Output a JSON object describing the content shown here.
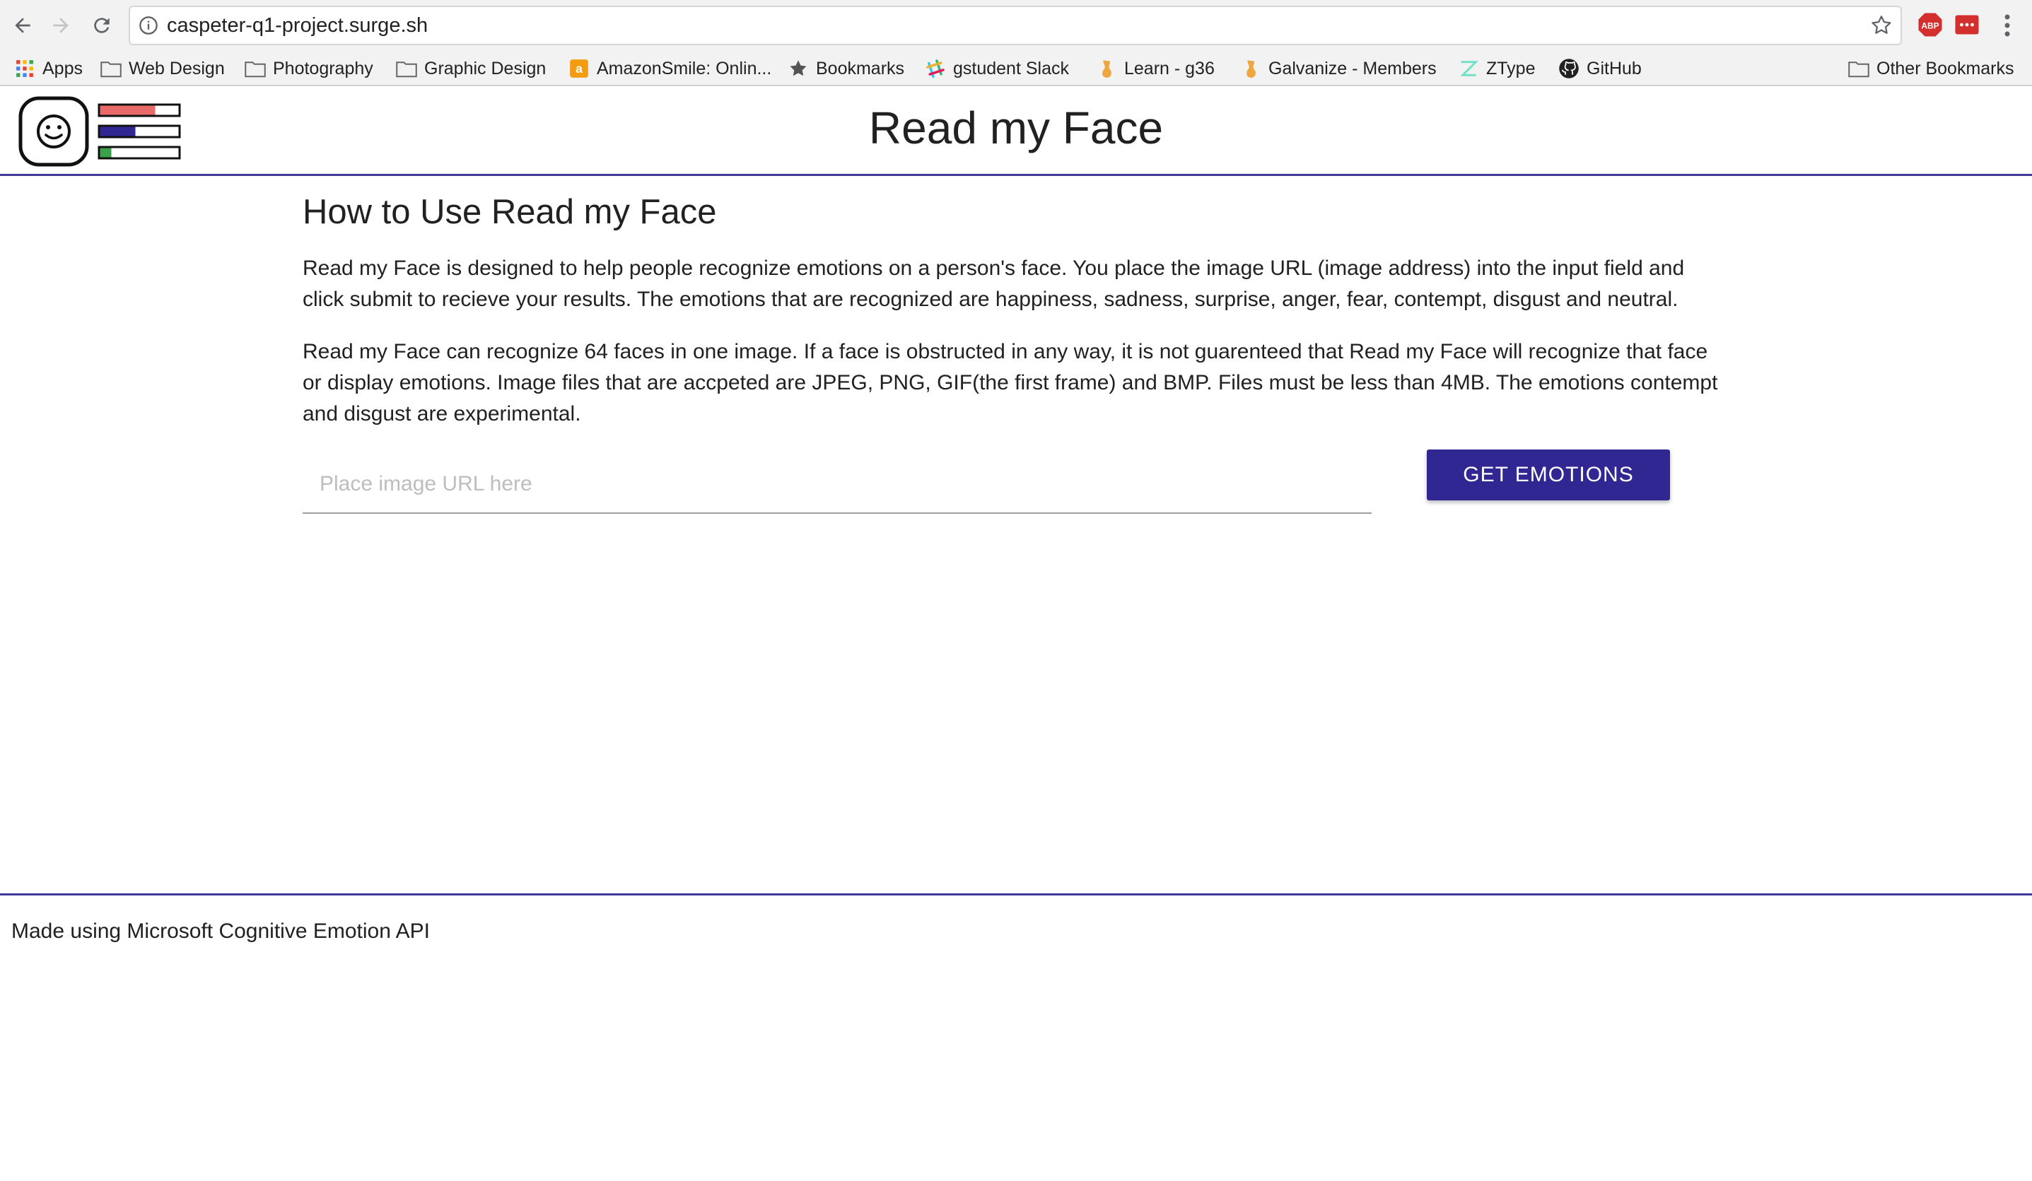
{
  "browser": {
    "url": "caspeter-q1-project.surge.sh",
    "bookmarks": [
      {
        "label": "Apps",
        "icon": "apps-grid-icon"
      },
      {
        "label": "Web Design",
        "icon": "folder-icon"
      },
      {
        "label": "Photography",
        "icon": "folder-icon"
      },
      {
        "label": "Graphic Design",
        "icon": "folder-icon"
      },
      {
        "label": "AmazonSmile: Onlin...",
        "icon": "amazon-icon"
      },
      {
        "label": "Bookmarks",
        "icon": "star-icon"
      },
      {
        "label": "gstudent Slack",
        "icon": "slack-icon"
      },
      {
        "label": "Learn - g36",
        "icon": "galvanize-icon"
      },
      {
        "label": "Galvanize - Members",
        "icon": "galvanize-icon"
      },
      {
        "label": "ZType",
        "icon": "ztype-icon"
      },
      {
        "label": "GitHub",
        "icon": "github-icon"
      },
      {
        "label": "Other Bookmarks",
        "icon": "folder-icon"
      }
    ]
  },
  "header": {
    "title": "Read my Face"
  },
  "main": {
    "heading": "How to Use Read my Face",
    "paragraph1": "Read my Face is designed to help people recognize emotions on a person's face. You place the image URL (image address) into the input field and click submit to recieve your results. The emotions that are recognized are happiness, sadness, surprise, anger, fear, contempt, disgust and neutral.",
    "paragraph2": "Read my Face can recognize 64 faces in one image. If a face is obstructed in any way, it is not guarenteed that Read my Face will recognize that face or display emotions. Image files that are accpeted are JPEG, PNG, GIF(the first frame) and BMP. Files must be less than 4MB. The emotions contempt and disgust are experimental.",
    "input_placeholder": "Place image URL here",
    "input_value": "",
    "button_label": "GET EMOTIONS"
  },
  "footer": {
    "text": "Made using Microsoft Cognitive Emotion API"
  },
  "colors": {
    "accent": "#312792",
    "divider": "#3f3a9a",
    "logo_red": "#e86a6a",
    "logo_blue": "#312792",
    "logo_green": "#3aa14a"
  }
}
